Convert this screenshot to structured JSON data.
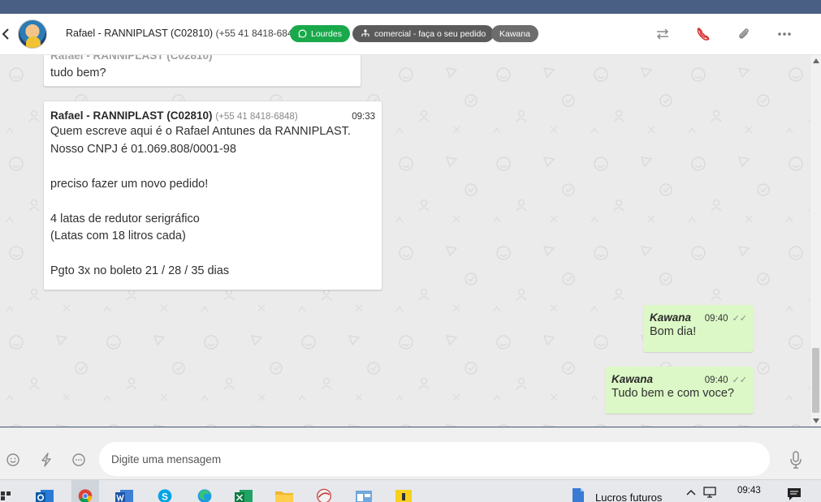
{
  "header": {
    "contact_name": "Rafael - RANNIPLAST (C02810)",
    "contact_phone": "(+55 41 8418-6848)",
    "tags": {
      "agent": "Lourdes",
      "department": "comercial - faça o seu pedido",
      "user": "Kawana"
    },
    "colors": {
      "agent_tag": "#19a94b",
      "department_tag": "#5b5b5b",
      "user_tag": "#6d6d6d",
      "end_call": "#d93a3a"
    }
  },
  "messages": [
    {
      "direction": "in",
      "text": "tudo bem?"
    },
    {
      "direction": "in",
      "sender": "Rafael - RANNIPLAST (C02810)",
      "phone": "(+55 41 8418-6848)",
      "time": "09:33",
      "text": "Quem escreve aqui é o Rafael Antunes da RANNIPLAST.\nNosso CNPJ é 01.069.808/0001-98\n\npreciso fazer um novo pedido!\n\n4 latas de redutor serigráfico\n(Latas com 18 litros cada)\n\nPgto 3x no boleto 21 / 28 / 35 dias"
    },
    {
      "direction": "out",
      "sender": "Kawana",
      "time": "09:40",
      "text": "Bom dia!"
    },
    {
      "direction": "out",
      "sender": "Kawana",
      "time": "09:40",
      "text": "Tudo bem e com voce?"
    }
  ],
  "composer": {
    "placeholder": "Digite uma mensagem"
  },
  "taskbar": {
    "active_window_label": "Lucros futuros",
    "clock": "09:43"
  }
}
